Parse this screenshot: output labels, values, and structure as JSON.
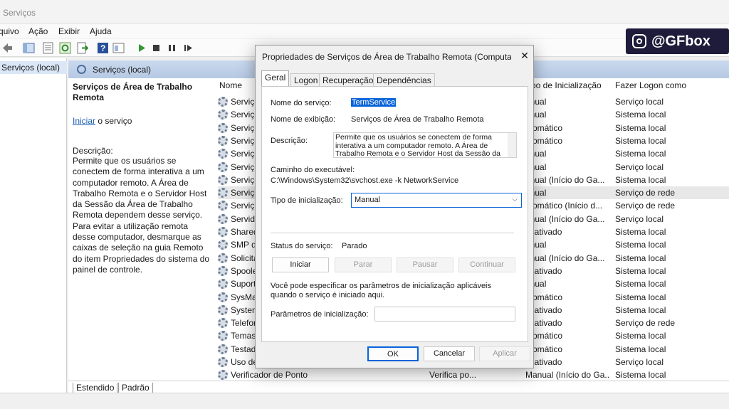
{
  "window": {
    "title": "Serviços"
  },
  "menu": [
    "quivo",
    "Ação",
    "Exibir",
    "Ajuda"
  ],
  "toolbar_icons": [
    "back-arrow-icon",
    "console-tree-icon",
    "properties-icon",
    "refresh-icon",
    "export-icon",
    "help-icon",
    "console-icon",
    "play-icon",
    "stop-icon",
    "pause-icon",
    "restart-icon"
  ],
  "tree": {
    "selected": "Serviços (local)"
  },
  "main": {
    "header": "Serviços (local)",
    "service_title": "Serviços de Área de Trabalho Remota",
    "start_link": "Iniciar",
    "start_suffix": " o serviço",
    "desc_heading": "Descrição:",
    "desc_text": "Permite que os usuários se conectem de forma interativa a um computador remoto. A Área de Trabalho Remota e o Servidor Host da Sessão da Área de Trabalho Remota dependem desse serviço. Para evitar a utilização remota desse computador, desmarque as caixas de seleção na guia Remoto do item Propriedades do sistema do painel de controle."
  },
  "columns": {
    "name": "Nome",
    "startup": "po de Inicialização",
    "logon": "Fazer Logon como"
  },
  "rows": [
    {
      "name": "Serviço",
      "desc": "",
      "startup": "anual",
      "logon": "Serviço local"
    },
    {
      "name": "Serviço",
      "desc": "",
      "startup": "anual",
      "logon": "Sistema local"
    },
    {
      "name": "Serviço",
      "desc": "",
      "startup": "utomático",
      "logon": "Sistema local"
    },
    {
      "name": "Serviço",
      "desc": "",
      "startup": "utomático",
      "logon": "Sistema local"
    },
    {
      "name": "Serviço",
      "desc": "",
      "startup": "anual",
      "logon": "Sistema local"
    },
    {
      "name": "Serviço",
      "desc": "",
      "startup": "anual",
      "logon": "Serviço local"
    },
    {
      "name": "Serviço",
      "desc": "",
      "startup": "anual (Início do Ga...",
      "logon": "Sistema local"
    },
    {
      "name": "Serviço",
      "desc": "",
      "startup": "anual",
      "logon": "Serviço de rede"
    },
    {
      "name": "Serviço",
      "desc": "",
      "startup": "utomático (Início d...",
      "logon": "Serviço de rede"
    },
    {
      "name": "Servido",
      "desc": "",
      "startup": "anual (Início do Ga...",
      "logon": "Serviço local"
    },
    {
      "name": "Shared",
      "desc": "",
      "startup": "esativado",
      "logon": "Sistema local"
    },
    {
      "name": "SMP d",
      "desc": "",
      "startup": "anual",
      "logon": "Sistema local"
    },
    {
      "name": "Solicita",
      "desc": "",
      "startup": "anual (Início do Ga...",
      "logon": "Sistema local"
    },
    {
      "name": "Spoole",
      "desc": "",
      "startup": "esativado",
      "logon": "Sistema local"
    },
    {
      "name": "Suport",
      "desc": "",
      "startup": "anual",
      "logon": "Sistema local"
    },
    {
      "name": "SysMai",
      "desc": "",
      "startup": "utomático",
      "logon": "Sistema local"
    },
    {
      "name": "System",
      "desc": "",
      "startup": "esativado",
      "logon": "Sistema local"
    },
    {
      "name": "Telefor",
      "desc": "",
      "startup": "esativado",
      "logon": "Serviço de rede"
    },
    {
      "name": "Temas",
      "desc": "",
      "startup": "utomático",
      "logon": "Sistema local"
    },
    {
      "name": "Testad",
      "desc": "",
      "startup": "utomático",
      "logon": "Sistema local"
    },
    {
      "name": "Uso de",
      "desc": "",
      "startup": "esativado",
      "logon": "Serviço local"
    },
    {
      "name": "Verificador de Ponto",
      "desc": "Verifica po...",
      "startup": "Manual (Início do Ga...",
      "logon": "Sistema local"
    }
  ],
  "bottom_tabs": [
    "Estendido",
    "Padrão"
  ],
  "badge": {
    "text": "@GFbox"
  },
  "dialog": {
    "title": "Propriedades de Serviços de Área de Trabalho Remota (Computad...",
    "tabs": [
      "Geral",
      "Logon",
      "Recuperação",
      "Dependências"
    ],
    "service_name_label": "Nome do serviço:",
    "service_name": "TermService",
    "display_name_label": "Nome de exibição:",
    "display_name": "Serviços de Área de Trabalho Remota",
    "description_label": "Descrição:",
    "description": "Permite que os usuários se conectem de forma interativa a um computador remoto. A Área de Trabalho Remota e o Servidor Host da Sessão da",
    "exec_label": "Caminho do executável:",
    "exec_path": "C:\\Windows\\System32\\svchost.exe -k NetworkService",
    "startup_label": "Tipo de inicialização:",
    "startup_value": "Manual",
    "status_label": "Status do serviço:",
    "status_value": "Parado",
    "btn_start": "Iniciar",
    "btn_stop": "Parar",
    "btn_pause": "Pausar",
    "btn_continue": "Continuar",
    "hint": "Você pode especificar os parâmetros de inicialização aplicáveis quando o serviço é iniciado aqui.",
    "params_label": "Parâmetros de inicialização:",
    "params_value": "",
    "ok": "OK",
    "cancel": "Cancelar",
    "apply": "Aplicar"
  }
}
